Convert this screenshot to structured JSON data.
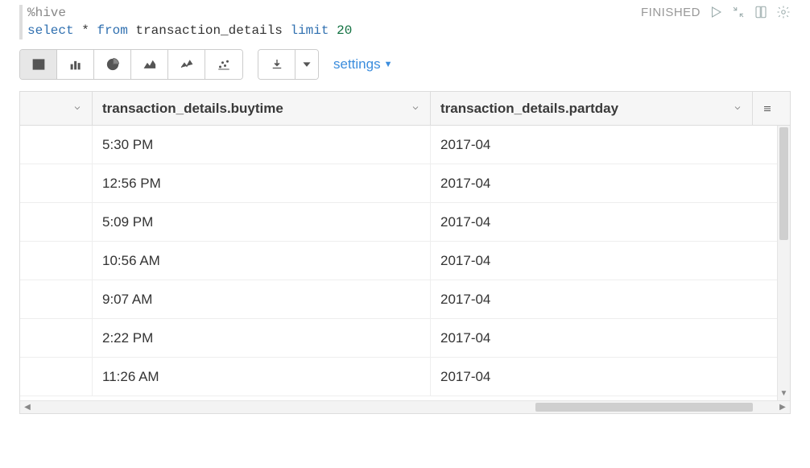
{
  "status": "FINISHED",
  "code": {
    "magic": "%hive",
    "line2_pre": "select",
    "line2_mid": " * ",
    "line2_from": "from",
    "line2_table": " transaction_details ",
    "line2_limit": "limit",
    "line2_num": " 20"
  },
  "settings_label": "settings",
  "columns": [
    "",
    "transaction_details.buytime",
    "transaction_details.partday"
  ],
  "rows": [
    {
      "buytime": "5:30 PM",
      "partday": "2017-04"
    },
    {
      "buytime": "12:56 PM",
      "partday": "2017-04"
    },
    {
      "buytime": "5:09 PM",
      "partday": "2017-04"
    },
    {
      "buytime": "10:56 AM",
      "partday": "2017-04"
    },
    {
      "buytime": "9:07 AM",
      "partday": "2017-04"
    },
    {
      "buytime": "2:22 PM",
      "partday": "2017-04"
    },
    {
      "buytime": "11:26 AM",
      "partday": "2017-04"
    }
  ]
}
